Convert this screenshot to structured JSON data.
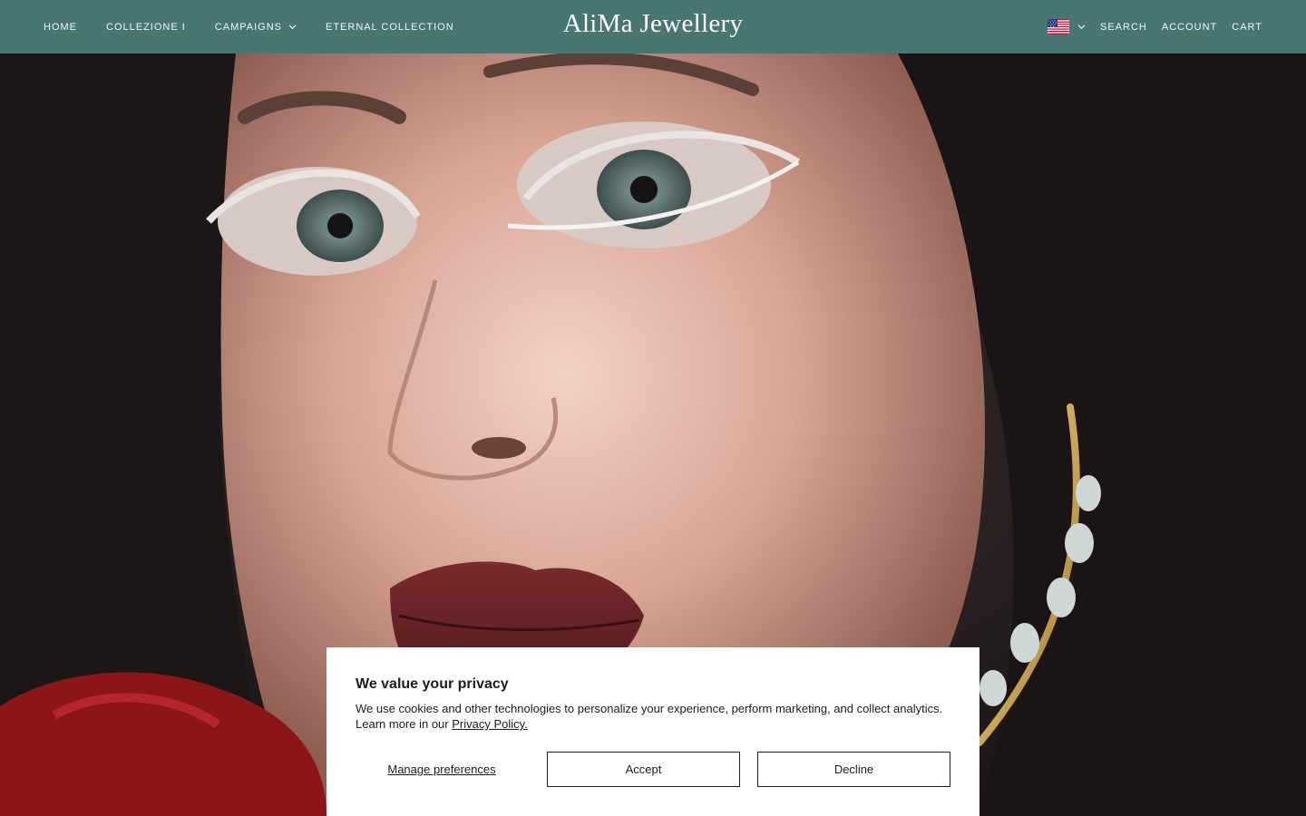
{
  "header": {
    "nav_left": [
      {
        "label": "HOME"
      },
      {
        "label": "COLLEZIONE I"
      },
      {
        "label": "CAMPAIGNS"
      },
      {
        "label": "ETERNAL COLLECTION"
      }
    ],
    "logo": "AliMa Jewellery",
    "nav_right": {
      "currency_flag": "us-flag-icon",
      "search": "SEARCH",
      "account": "ACCOUNT",
      "cart": "CART"
    },
    "background_color": "#487673"
  },
  "hero": {
    "image": "portrait-with-glitter-eye-makeup-and-gold-earring"
  },
  "cookie_banner": {
    "title": "We value your privacy",
    "body": "We use cookies and other technologies to personalize your experience, perform marketing, and collect analytics. Learn more in our",
    "link": "Privacy Policy.",
    "manage_label": "Manage preferences",
    "accept_label": "Accept",
    "decline_label": "Decline"
  }
}
